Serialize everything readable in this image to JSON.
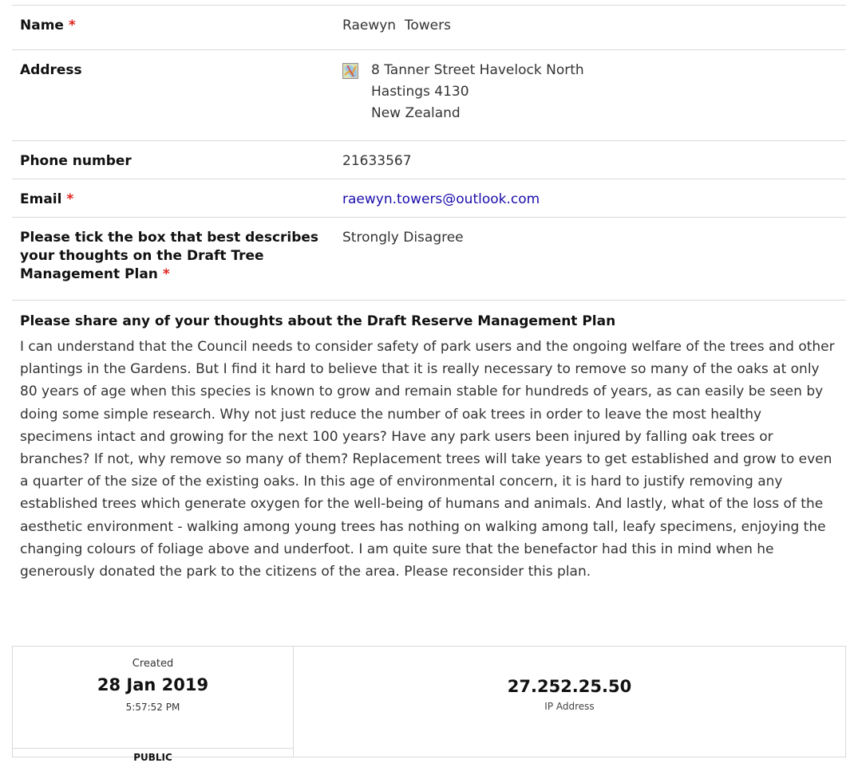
{
  "form": {
    "name": {
      "label": "Name",
      "required_mark": "*",
      "value": "Raewyn  Towers"
    },
    "address": {
      "label": "Address",
      "icon": "map-icon",
      "lines": [
        "8 Tanner Street Havelock North",
        "Hastings 4130",
        "New Zealand"
      ]
    },
    "phone": {
      "label": "Phone number",
      "value": "21633567"
    },
    "email": {
      "label": "Email",
      "required_mark": "*",
      "value": "raewyn.towers@outlook.com"
    },
    "tick": {
      "label": "Please tick the box that best describes your thoughts on the Draft Tree Management Plan",
      "required_mark": "*",
      "value": "Strongly Disagree"
    },
    "thoughts": {
      "label": "Please share any of your thoughts about the Draft Reserve Management Plan",
      "value": "I can understand that the Council needs to consider safety of park users and the ongoing welfare of the trees and other plantings in the Gardens. But I find it hard to believe that it is really necessary to remove so many of the oaks at only 80 years of age when this species is known to grow and remain stable for hundreds of years, as can easily be seen by doing some simple research. Why not just reduce the number of oak trees in order to leave the most healthy specimens intact and growing for the next 100 years? Have any park users been injured by falling oak trees or branches? If not, why remove so many of them? Replacement trees will take years to get established and grow to even a quarter of the size of the existing oaks. In this age of environmental concern, it is hard to justify removing any established trees which generate oxygen for the well-being of humans and animals. And lastly, what of the loss of the aesthetic environment - walking among young trees has nothing on walking among tall, leafy specimens, enjoying the changing colours of foliage above and underfoot. I am quite sure that the benefactor had this in mind when he generously donated the park to the citizens of the area. Please reconsider this plan."
    }
  },
  "meta": {
    "created_label": "Created",
    "created_date": "28 Jan 2019",
    "created_time": "5:57:52 PM",
    "visibility": "PUBLIC",
    "ip_value": "27.252.25.50",
    "ip_label": "IP Address"
  },
  "colors": {
    "required": "#e0201a",
    "link": "#1a0dab",
    "border": "#d9d9d9"
  }
}
